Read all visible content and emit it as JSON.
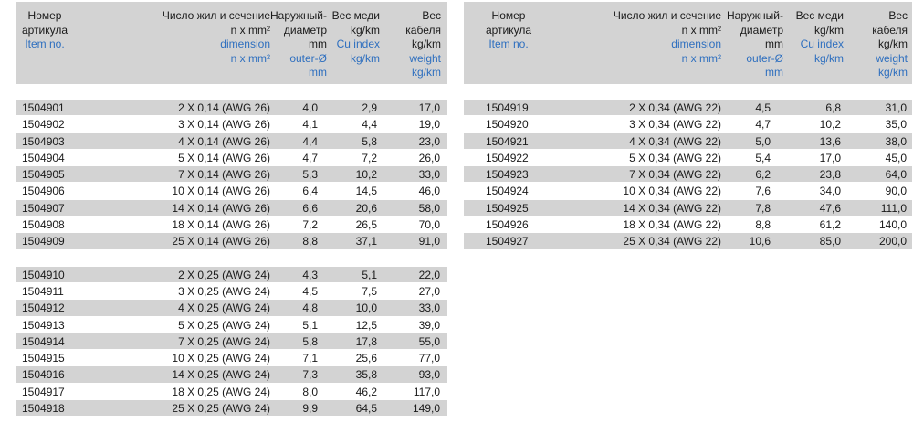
{
  "header": {
    "item": {
      "ru": [
        "Номер",
        "артикула"
      ],
      "en": [
        "Item no."
      ]
    },
    "dimension": {
      "ru": [
        "Число жил и сечение",
        "n x mm²"
      ],
      "en": [
        "dimension",
        "n x mm²"
      ]
    },
    "outer": {
      "ru": [
        "Наружный-",
        "диаметр",
        "mm"
      ],
      "en": [
        "outer-Ø",
        "mm"
      ]
    },
    "cu": {
      "ru": [
        "Вес меди",
        "kg/km"
      ],
      "en": [
        "Cu index",
        "kg/km"
      ]
    },
    "weight": {
      "ru": [
        "Вес",
        "кабеля",
        "kg/km"
      ],
      "en": [
        "weight",
        "kg/km"
      ]
    }
  },
  "left_groups": [
    [
      [
        "1504901",
        "2 X 0,14 (AWG 26)",
        "4,0",
        "2,9",
        "17,0"
      ],
      [
        "1504902",
        "3 X 0,14 (AWG 26)",
        "4,1",
        "4,4",
        "19,0"
      ],
      [
        "1504903",
        "4 X 0,14 (AWG 26)",
        "4,4",
        "5,8",
        "23,0"
      ],
      [
        "1504904",
        "5 X 0,14 (AWG 26)",
        "4,7",
        "7,2",
        "26,0"
      ],
      [
        "1504905",
        "7 X 0,14 (AWG 26)",
        "5,3",
        "10,2",
        "33,0"
      ],
      [
        "1504906",
        "10 X 0,14 (AWG 26)",
        "6,4",
        "14,5",
        "46,0"
      ],
      [
        "1504907",
        "14 X 0,14 (AWG 26)",
        "6,6",
        "20,6",
        "58,0"
      ],
      [
        "1504908",
        "18 X 0,14 (AWG 26)",
        "7,2",
        "26,5",
        "70,0"
      ],
      [
        "1504909",
        "25 X 0,14 (AWG 26)",
        "8,8",
        "37,1",
        "91,0"
      ]
    ],
    [
      [
        "1504910",
        "2 X 0,25 (AWG 24)",
        "4,3",
        "5,1",
        "22,0"
      ],
      [
        "1504911",
        "3 X 0,25 (AWG 24)",
        "4,5",
        "7,5",
        "27,0"
      ],
      [
        "1504912",
        "4 X 0,25 (AWG 24)",
        "4,8",
        "10,0",
        "33,0"
      ],
      [
        "1504913",
        "5 X 0,25 (AWG 24)",
        "5,1",
        "12,5",
        "39,0"
      ],
      [
        "1504914",
        "7 X 0,25 (AWG 24)",
        "5,8",
        "17,8",
        "55,0"
      ],
      [
        "1504915",
        "10 X 0,25 (AWG 24)",
        "7,1",
        "25,6",
        "77,0"
      ],
      [
        "1504916",
        "14 X 0,25 (AWG 24)",
        "7,3",
        "35,8",
        "93,0"
      ],
      [
        "1504917",
        "18 X 0,25 (AWG 24)",
        "8,0",
        "46,2",
        "117,0"
      ],
      [
        "1504918",
        "25 X 0,25 (AWG 24)",
        "9,9",
        "64,5",
        "149,0"
      ]
    ]
  ],
  "right_groups": [
    [
      [
        "1504919",
        "2 X 0,34 (AWG 22)",
        "4,5",
        "6,8",
        "31,0"
      ],
      [
        "1504920",
        "3 X 0,34 (AWG 22)",
        "4,7",
        "10,2",
        "35,0"
      ],
      [
        "1504921",
        "4 X 0,34 (AWG 22)",
        "5,0",
        "13,6",
        "38,0"
      ],
      [
        "1504922",
        "5 X 0,34 (AWG 22)",
        "5,4",
        "17,0",
        "45,0"
      ],
      [
        "1504923",
        "7 X 0,34 (AWG 22)",
        "6,2",
        "23,8",
        "64,0"
      ],
      [
        "1504924",
        "10 X 0,34 (AWG 22)",
        "7,6",
        "34,0",
        "90,0"
      ],
      [
        "1504925",
        "14 X 0,34 (AWG 22)",
        "7,8",
        "47,6",
        "111,0"
      ],
      [
        "1504926",
        "18 X 0,34 (AWG 22)",
        "8,8",
        "61,2",
        "140,0"
      ],
      [
        "1504927",
        "25 X 0,34 (AWG 22)",
        "10,6",
        "85,0",
        "200,0"
      ]
    ]
  ],
  "colors": {
    "shade": "#d3d3d3",
    "english_label": "#2e6fbf",
    "text": "#1a1a1a"
  }
}
